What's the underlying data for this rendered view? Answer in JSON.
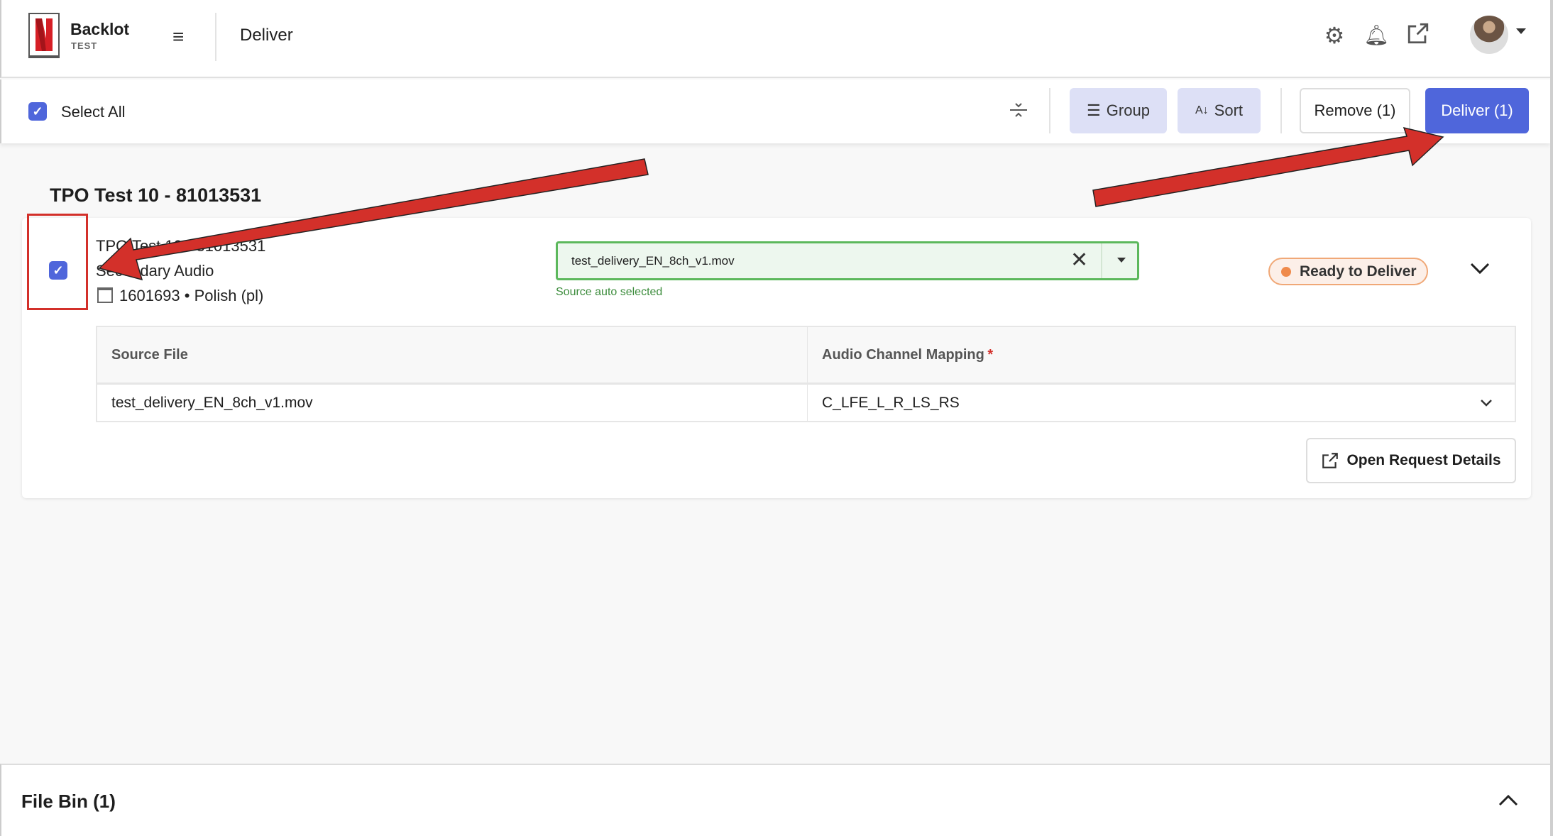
{
  "header": {
    "brand": "Backlot",
    "brand_sub": "TEST",
    "page_title": "Deliver"
  },
  "toolbar": {
    "select_all": "Select All",
    "group": "Group",
    "sort": "Sort",
    "remove": "Remove (1)",
    "deliver": "Deliver (1)"
  },
  "group": {
    "title": "TPO Test 10 - 81013531",
    "item": {
      "title": "TPO Test 10 - 81013531",
      "type": "Secondary Audio",
      "meta": "1601693 • Polish (pl)",
      "source_value": "test_delivery_EN_8ch_v1.mov",
      "source_helper": "Source auto selected",
      "status": "Ready to Deliver",
      "status_color": "#ef8a4b",
      "table": {
        "headers": [
          "Source File",
          "Audio Channel Mapping"
        ],
        "required_mark": "*",
        "rows": [
          [
            "test_delivery_EN_8ch_v1.mov",
            "C_LFE_L_R_LS_RS"
          ]
        ]
      },
      "open_details": "Open Request Details"
    }
  },
  "file_bin": {
    "title": "File Bin (1)"
  },
  "colors": {
    "accent": "#4f66db",
    "success": "#5cb85c",
    "annotation": "#d3302a"
  }
}
